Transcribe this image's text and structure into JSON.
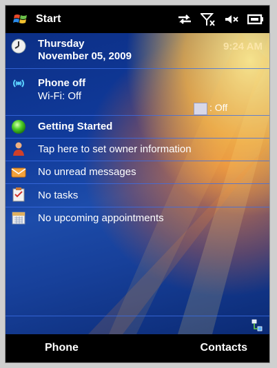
{
  "topbar": {
    "start_label": "Start",
    "icons": [
      "windows-flag-icon",
      "data-connection-icon",
      "no-signal-icon",
      "speaker-mute-icon",
      "battery-icon"
    ]
  },
  "today": {
    "date": {
      "day": "Thursday",
      "date": "November 05, 2009",
      "time": "9:24 AM"
    },
    "connectivity": {
      "phone": "Phone off",
      "wifi": "Wi-Fi: Off",
      "bluetooth": ": Off"
    },
    "getting_started": "Getting Started",
    "owner": "Tap here to set owner information",
    "messages": "No unread messages",
    "tasks": "No tasks",
    "appointments": "No upcoming appointments"
  },
  "softkeys": {
    "left": "Phone",
    "right": "Contacts"
  },
  "colors": {
    "background_blue": "#103a9a",
    "separator": "#3c6ee6",
    "glow": "#ffbe46"
  }
}
